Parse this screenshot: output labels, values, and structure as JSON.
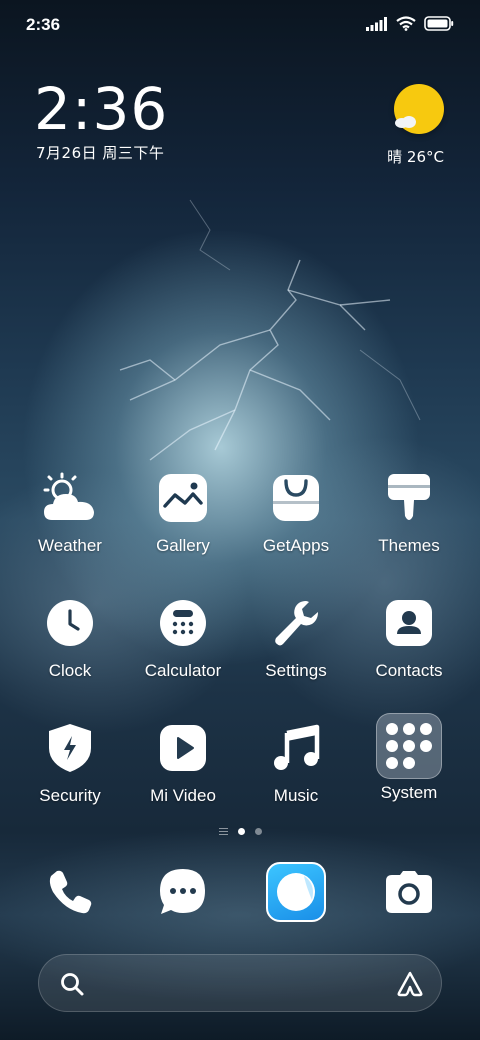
{
  "status_bar": {
    "time": "2:36",
    "icons": [
      "signal-icon",
      "wifi-icon",
      "battery-icon"
    ]
  },
  "clock_widget": {
    "time": "2:36",
    "date": "7月26日 周三下午"
  },
  "weather_widget": {
    "condition": "晴",
    "temperature": "26°C",
    "text": "晴 26°C",
    "icon": "sunny-icon"
  },
  "apps": [
    {
      "label": "Weather",
      "icon": "weather-icon"
    },
    {
      "label": "Gallery",
      "icon": "gallery-icon"
    },
    {
      "label": "GetApps",
      "icon": "getapps-icon"
    },
    {
      "label": "Themes",
      "icon": "themes-icon"
    },
    {
      "label": "Clock",
      "icon": "clock-icon"
    },
    {
      "label": "Calculator",
      "icon": "calculator-icon"
    },
    {
      "label": "Settings",
      "icon": "settings-icon"
    },
    {
      "label": "Contacts",
      "icon": "contacts-icon"
    },
    {
      "label": "Security",
      "icon": "security-icon"
    },
    {
      "label": "Mi Video",
      "icon": "video-icon"
    },
    {
      "label": "Music",
      "icon": "music-icon"
    },
    {
      "label": "System",
      "icon": "folder-icon"
    }
  ],
  "page_indicator": {
    "pages": 2,
    "active_page": 1
  },
  "dock": [
    {
      "name": "phone",
      "icon": "phone-icon"
    },
    {
      "name": "messages",
      "icon": "messages-icon"
    },
    {
      "name": "browser",
      "icon": "browser-icon"
    },
    {
      "name": "camera",
      "icon": "camera-icon"
    }
  ],
  "search_bar": {
    "placeholder": "",
    "icon": "search-icon",
    "assistant_icon": "assistant-icon"
  }
}
